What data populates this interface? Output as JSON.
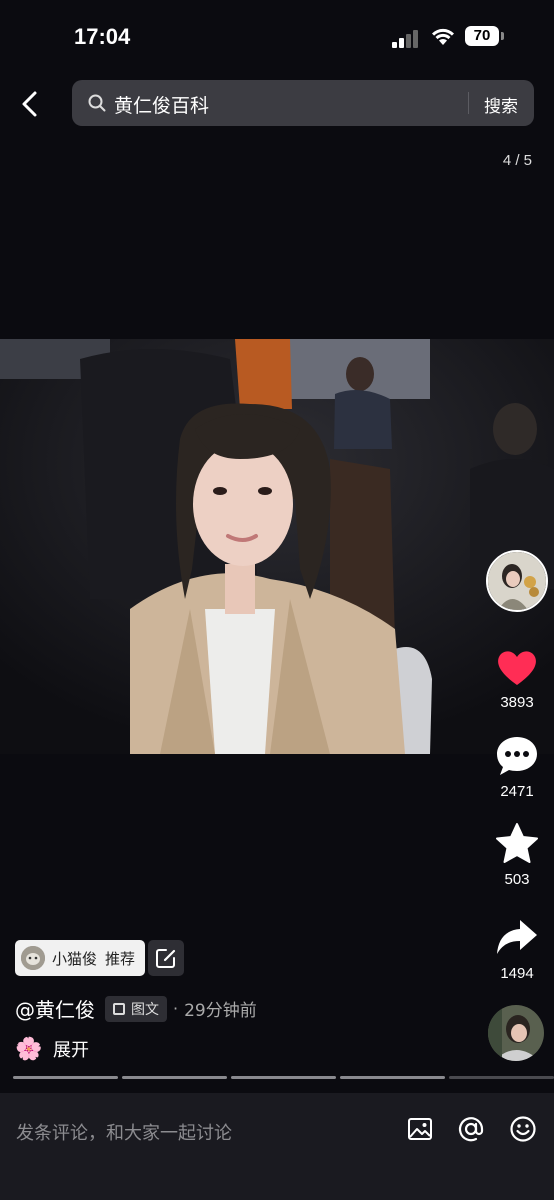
{
  "status_bar": {
    "time": "17:04",
    "battery": "70"
  },
  "search": {
    "query": "黄仁俊百科",
    "button": "搜索"
  },
  "page_indicator": "4 / 5",
  "actions": {
    "likes": "3893",
    "comments": "2471",
    "favorites": "503",
    "shares": "1494"
  },
  "post": {
    "recommend_user": "小猫俊",
    "recommend_label": "推荐",
    "author": "@黄仁俊",
    "tag": "图文",
    "separator": "·",
    "time_ago": "29分钟前",
    "expand_emoji": "🌸",
    "expand": "展开"
  },
  "progress": {
    "segments": 5,
    "current": 4
  },
  "comment_bar": {
    "placeholder": "发条评论，和大家一起讨论"
  },
  "colors": {
    "background": "#0b0b10",
    "like": "#ff2d55",
    "search_bg": "#3c3c42"
  },
  "icons": [
    "back-icon",
    "search-icon",
    "heart-icon",
    "comment-icon",
    "star-icon",
    "share-icon",
    "image-icon",
    "at-icon",
    "emoji-icon",
    "edit-icon"
  ]
}
